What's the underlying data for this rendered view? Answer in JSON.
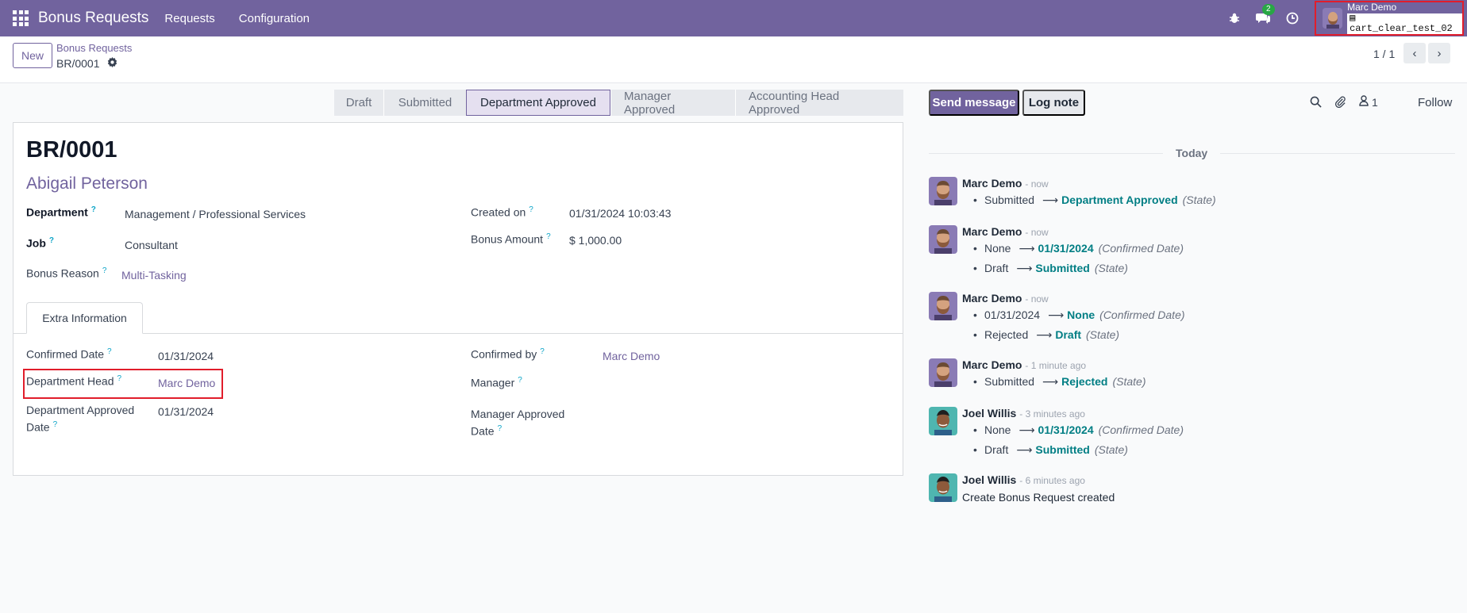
{
  "navbar": {
    "brand": "Bonus Requests",
    "menu": [
      "Requests",
      "Configuration"
    ],
    "messages_badge": "2",
    "user_name": "Marc Demo",
    "database": "cart_clear_test_02"
  },
  "control": {
    "new_label": "New",
    "breadcrumb_parent": "Bonus Requests",
    "breadcrumb_current": "BR/0001",
    "pager": "1 / 1"
  },
  "statusbar": {
    "stages": [
      "Draft",
      "Submitted",
      "Department Approved",
      "Manager Approved",
      "Accounting Head Approved"
    ],
    "active": "Department Approved"
  },
  "form": {
    "title": "BR/0001",
    "employee": "Abigail Peterson",
    "department_label": "Department",
    "department": "Management / Professional Services",
    "job_label": "Job",
    "job": "Consultant",
    "bonus_reason_label": "Bonus Reason",
    "bonus_reason": "Multi-Tasking",
    "created_on_label": "Created on",
    "created_on": "01/31/2024 10:03:43",
    "bonus_amount_label": "Bonus Amount",
    "bonus_amount": "$ 1,000.00",
    "tab_label": "Extra Information",
    "confirmed_date_label": "Confirmed Date",
    "confirmed_date": "01/31/2024",
    "department_head_label": "Department Head",
    "department_head": "Marc Demo",
    "dept_approved_date_label_1": "Department Approved",
    "dept_approved_date_label_2": "Date",
    "dept_approved_date": "01/31/2024",
    "confirmed_by_label": "Confirmed by",
    "confirmed_by": "Marc Demo",
    "manager_label": "Manager",
    "manager_approved_date_label_1": "Manager Approved",
    "manager_approved_date_label_2": "Date"
  },
  "chatter": {
    "send_message": "Send message",
    "log_note": "Log note",
    "followers_count": "1",
    "follow": "Follow",
    "today": "Today",
    "messages": [
      {
        "author": "Marc Demo",
        "time": "- now",
        "changes": [
          {
            "old": "Submitted",
            "new": "Department Approved",
            "field": "(State)"
          }
        ]
      },
      {
        "author": "Marc Demo",
        "time": "- now",
        "changes": [
          {
            "old": "None",
            "new": "01/31/2024",
            "field": "(Confirmed Date)"
          },
          {
            "old": "Draft",
            "new": "Submitted",
            "field": "(State)"
          }
        ]
      },
      {
        "author": "Marc Demo",
        "time": "- now",
        "changes": [
          {
            "old": "01/31/2024",
            "new": "None",
            "field": "(Confirmed Date)"
          },
          {
            "old": "Rejected",
            "new": "Draft",
            "field": "(State)"
          }
        ]
      },
      {
        "author": "Marc Demo",
        "time": "- 1 minute ago",
        "changes": [
          {
            "old": "Submitted",
            "new": "Rejected",
            "field": "(State)"
          }
        ]
      },
      {
        "author": "Joel Willis",
        "time": "- 3 minutes ago",
        "changes": [
          {
            "old": "None",
            "new": "01/31/2024",
            "field": "(Confirmed Date)"
          },
          {
            "old": "Draft",
            "new": "Submitted",
            "field": "(State)"
          }
        ]
      },
      {
        "author": "Joel Willis",
        "time": "- 6 minutes ago",
        "body": "Create Bonus Request created"
      }
    ]
  }
}
